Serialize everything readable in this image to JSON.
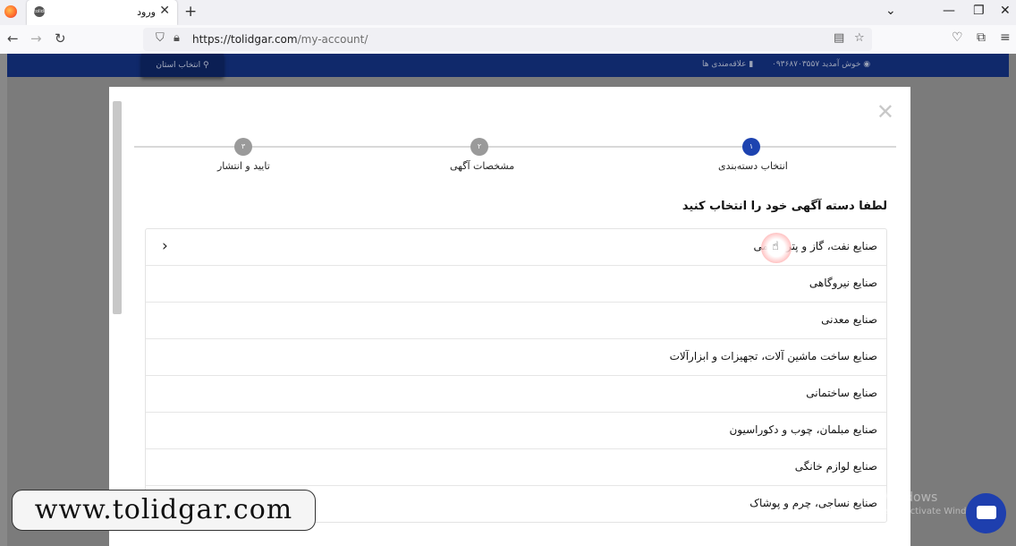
{
  "browser": {
    "tab_title": "ورود",
    "tab_favicon": "tolidgar",
    "url_host": "https://tolidgar.com",
    "url_path": "/my-account/"
  },
  "site_header": {
    "province_button": "انتخاب استان",
    "welcome": "خوش آمدید ۰۹۳۶۸۷۰۳۵۵۷",
    "favorites": "علاقه‌مندی ها"
  },
  "modal": {
    "steps": [
      {
        "number": "۱",
        "label": "انتخاب دسته‌بندی",
        "active": true
      },
      {
        "number": "۲",
        "label": "مشخصات آگهی",
        "active": false
      },
      {
        "number": "۳",
        "label": "تایید و انتشار",
        "active": false
      }
    ],
    "prompt": "لطفا دسته آگهی خود را انتخاب کنید",
    "categories": [
      "صنایع نفت، گاز و پتروشیمی",
      "صنایع نیروگاهی",
      "صنایع معدنی",
      "صنایع ساخت ماشین آلات، تجهیزات و ابزارآلات",
      "صنایع ساختمانی",
      "صنایع مبلمان، چوب و دکوراسیون",
      "صنایع لوازم خانگی",
      "صنایع نساجی، چرم و پوشاک"
    ]
  },
  "colors": {
    "active_step": "#1d43b0",
    "inactive_step": "#9a9a9a",
    "site_header": "#10296b",
    "chat_button": "#1e3fae"
  },
  "overlay": {
    "watermark": "www.tolidgar.com",
    "activate_title": "Activate Windows",
    "activate_subtitle": "Go to Settings to activate Windows."
  }
}
